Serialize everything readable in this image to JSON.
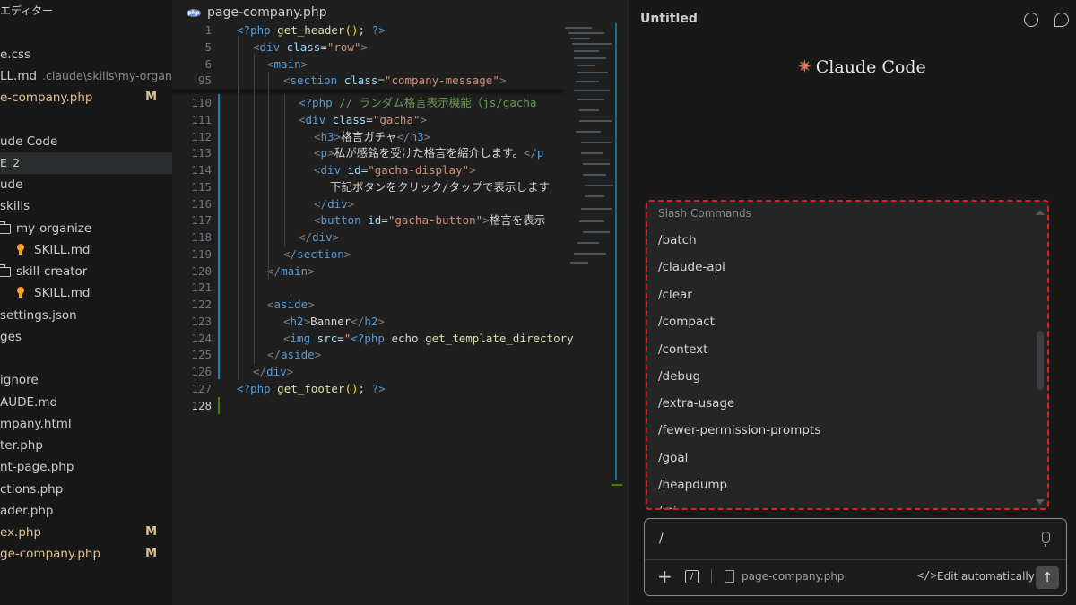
{
  "explorer": {
    "header": "エディター",
    "items": [
      {
        "label": "e.css"
      },
      {
        "label": "LL.md",
        "detail": ".claude\\skills\\my-organize"
      },
      {
        "label": "e-company.php",
        "badge": "M"
      },
      {
        "label": "ude Code"
      },
      {
        "label": "E_2"
      },
      {
        "label": "ude"
      },
      {
        "label": "skills"
      },
      {
        "label": "my-organize"
      },
      {
        "label": "SKILL.md"
      },
      {
        "label": "skill-creator"
      },
      {
        "label": "SKILL.md"
      },
      {
        "label": "settings.json"
      },
      {
        "label": "ges"
      },
      {
        "label": "ignore"
      },
      {
        "label": "AUDE.md"
      },
      {
        "label": "mpany.html"
      },
      {
        "label": "ter.php"
      },
      {
        "label": "nt-page.php"
      },
      {
        "label": "ctions.php"
      },
      {
        "label": "ader.php"
      },
      {
        "label": "ex.php",
        "badge": "M"
      },
      {
        "label": "ge-company.php",
        "badge": "M"
      }
    ]
  },
  "editor": {
    "tab_label": "page-company.php",
    "tab_badge": "php",
    "line_numbers": [
      "1",
      "5",
      "6",
      "95",
      "110",
      "111",
      "112",
      "113",
      "114",
      "115",
      "116",
      "117",
      "118",
      "119",
      "120",
      "121",
      "122",
      "123",
      "124",
      "125",
      "126",
      "127",
      "128"
    ]
  },
  "claude_panel": {
    "title": "Untitled",
    "logo_text": "Claude Code",
    "logo_glyph": "✷",
    "menu": {
      "header": "Slash Commands",
      "items": [
        "/batch",
        "/claude-api",
        "/clear",
        "/compact",
        "/context",
        "/debug",
        "/extra-usage",
        "/fewer-permission-prompts",
        "/goal",
        "/heapdump",
        "/ini"
      ]
    },
    "input": {
      "value": "/",
      "plus": "+",
      "slash_icon": "/",
      "file": "page-company.php",
      "code_icon": "</>",
      "mode": "Edit automatically",
      "send_glyph": "↑"
    }
  }
}
